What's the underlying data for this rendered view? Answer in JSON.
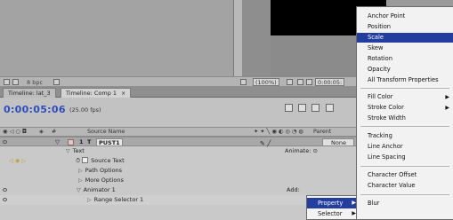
{
  "viewer": {
    "bpc": "8 bpc",
    "zoom": "(100%)",
    "timecode_mini": "0:00:05:"
  },
  "tabs": [
    {
      "label": "Timeline: lat_3"
    },
    {
      "label": "Timeline: Comp 1",
      "close": "×"
    }
  ],
  "timeline": {
    "timecode": "0:00:05:06",
    "fps": "(25.00 fps)"
  },
  "columns": {
    "hash": "#",
    "source_name": "Source Name",
    "parent": "Parent"
  },
  "layer": {
    "number": "1",
    "type_glyph": "T",
    "name": "PUST1",
    "parent_value": "None"
  },
  "rows": {
    "text": "Text",
    "animate": "Animate:",
    "source_text": "Source Text",
    "path_options": "Path Options",
    "more_options": "More Options",
    "animator": "Animator 1",
    "add": "Add:",
    "range_selector": "Range Selector 1"
  },
  "submenu": {
    "items": [
      {
        "label": "Property",
        "highlighted": true
      },
      {
        "label": "Selector",
        "highlighted": false
      }
    ]
  },
  "menu": {
    "groups": [
      [
        "Anchor Point",
        "Position",
        "Scale",
        "Skew",
        "Rotation",
        "Opacity",
        "All Transform Properties"
      ],
      [
        "Fill Color",
        "Stroke Color",
        "Stroke Width"
      ],
      [
        "Tracking",
        "Line Anchor",
        "Line Spacing"
      ],
      [
        "Character Offset",
        "Character Value"
      ],
      [
        "Blur"
      ]
    ],
    "highlighted": "Scale",
    "with_submenu": [
      "Fill Color",
      "Stroke Color"
    ]
  },
  "colors": {
    "highlight": "#243e9f",
    "timecode": "#2e4dbd"
  }
}
